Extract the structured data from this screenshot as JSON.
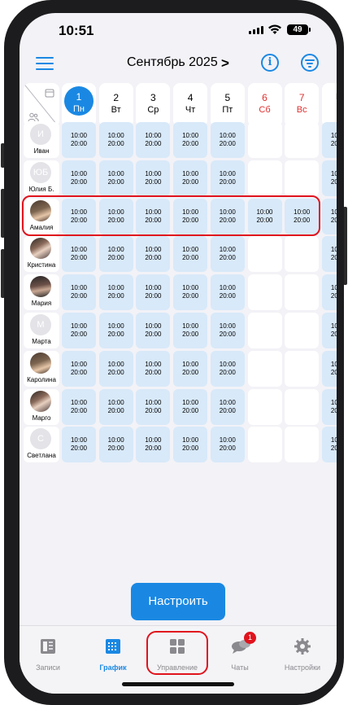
{
  "status": {
    "time": "10:51",
    "battery": "49"
  },
  "header": {
    "title": "Сентябрь 2025",
    "chevron": ">",
    "info_glyph": "i"
  },
  "days": [
    {
      "num": "1",
      "name": "Пн",
      "today": true,
      "weekend": false
    },
    {
      "num": "2",
      "name": "Вт",
      "today": false,
      "weekend": false
    },
    {
      "num": "3",
      "name": "Ср",
      "today": false,
      "weekend": false
    },
    {
      "num": "4",
      "name": "Чт",
      "today": false,
      "weekend": false
    },
    {
      "num": "5",
      "name": "Пт",
      "today": false,
      "weekend": false
    },
    {
      "num": "6",
      "name": "Сб",
      "today": false,
      "weekend": true
    },
    {
      "num": "7",
      "name": "Вс",
      "today": false,
      "weekend": true
    },
    {
      "num": "",
      "name": "П",
      "today": false,
      "weekend": false
    }
  ],
  "shift": {
    "start": "10:00",
    "end": "20:00"
  },
  "employees": [
    {
      "initials": "И",
      "name": "Иван",
      "avatar": "initials",
      "weekend_shift": false
    },
    {
      "initials": "ЮБ",
      "name": "Юлия Б.",
      "avatar": "initials",
      "weekend_shift": false
    },
    {
      "initials": "",
      "name": "Амалия",
      "avatar": "photo",
      "weekend_shift": true
    },
    {
      "initials": "",
      "name": "Кристина",
      "avatar": "photo2",
      "weekend_shift": false
    },
    {
      "initials": "",
      "name": "Мария",
      "avatar": "photo3",
      "weekend_shift": false
    },
    {
      "initials": "М",
      "name": "Марта",
      "avatar": "initials",
      "weekend_shift": false
    },
    {
      "initials": "",
      "name": "Каролина",
      "avatar": "photo",
      "weekend_shift": false
    },
    {
      "initials": "",
      "name": "Марго",
      "avatar": "photo2",
      "weekend_shift": false
    },
    {
      "initials": "С",
      "name": "Светлана",
      "avatar": "initials",
      "weekend_shift": false
    }
  ],
  "setup_button": "Настроить",
  "tabs": [
    {
      "label": "Записи",
      "icon": "records-icon",
      "active": false,
      "badge": ""
    },
    {
      "label": "График",
      "icon": "schedule-icon",
      "active": true,
      "badge": ""
    },
    {
      "label": "Управление",
      "icon": "management-icon",
      "active": false,
      "badge": ""
    },
    {
      "label": "Чаты",
      "icon": "chats-icon",
      "active": false,
      "badge": "1"
    },
    {
      "label": "Настройки",
      "icon": "settings-icon",
      "active": false,
      "badge": ""
    }
  ],
  "colors": {
    "accent": "#1a88e3",
    "shift_bg": "#d8e9f9",
    "weekend": "#e03030",
    "highlight": "#e0131d"
  }
}
